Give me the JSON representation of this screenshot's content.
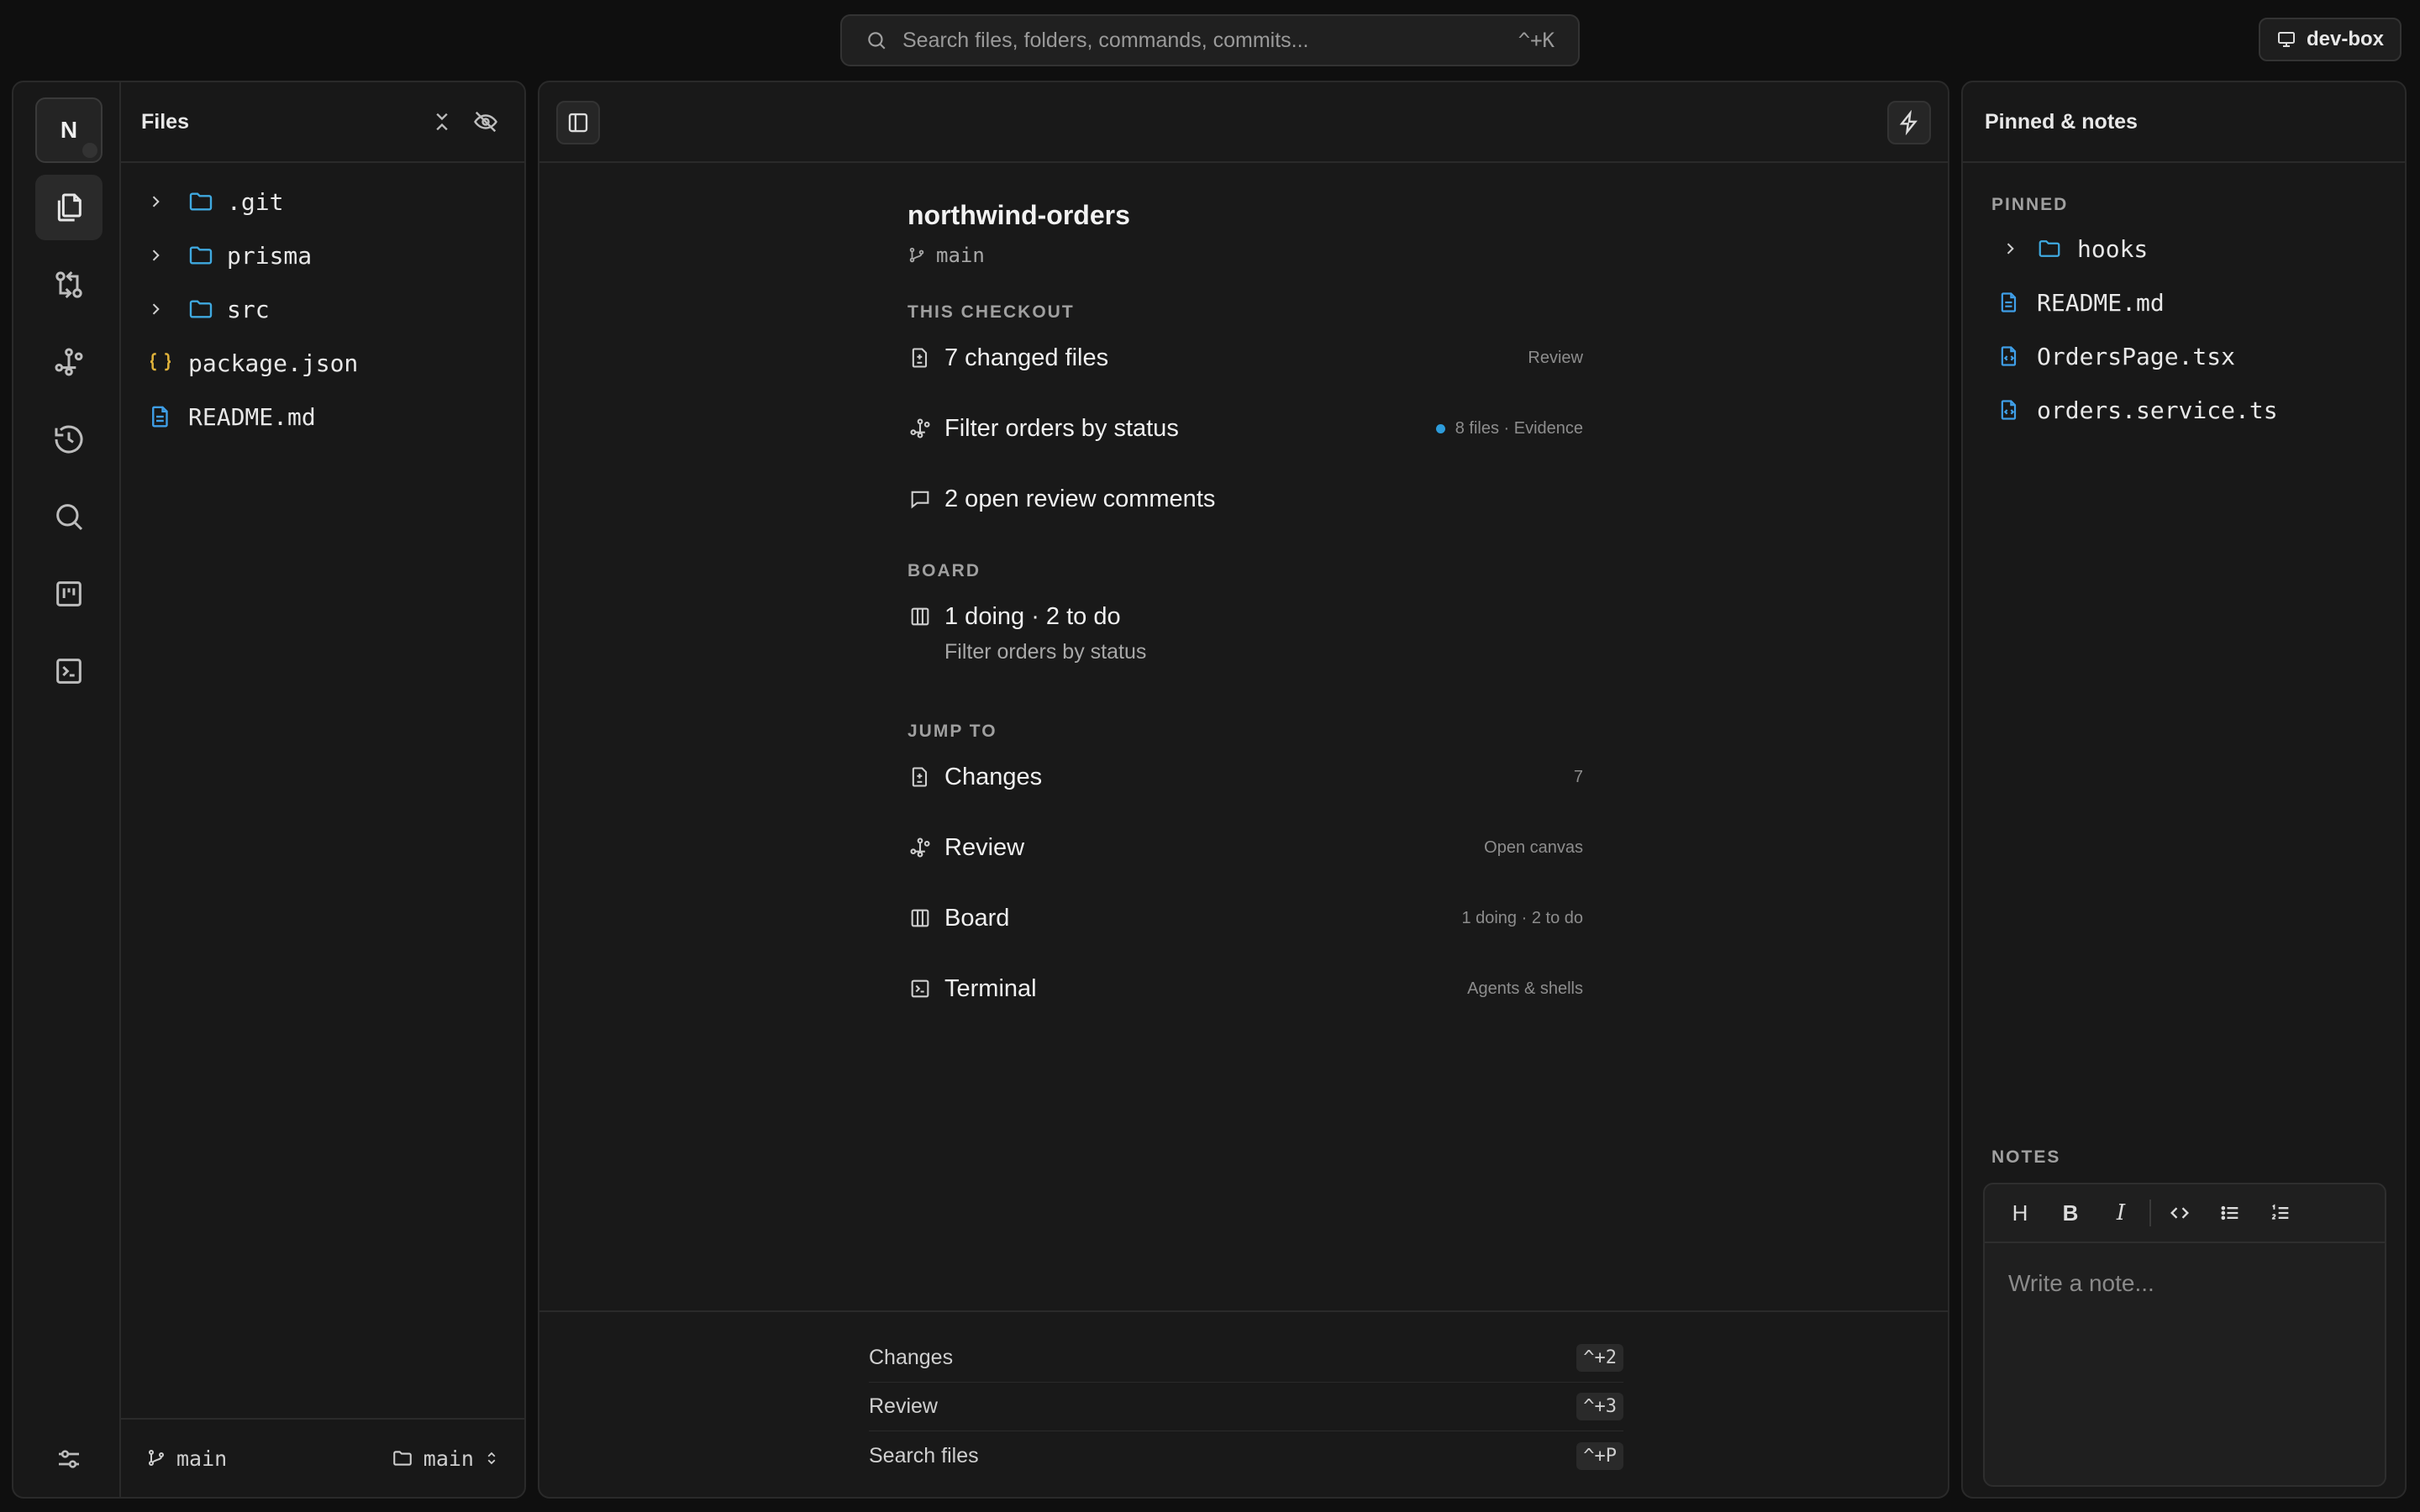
{
  "search": {
    "placeholder": "Search files, folders, commands, commits...",
    "shortcut": "^+K"
  },
  "machine": {
    "label": "dev-box"
  },
  "rail": {
    "avatar_letter": "N",
    "icons": [
      "files-icon",
      "git-compare-icon",
      "workflow-icon",
      "history-icon",
      "search-icon",
      "kanban-icon",
      "terminal-icon"
    ],
    "bottom_icon": "settings-sliders-icon"
  },
  "files_panel": {
    "title": "Files",
    "tree": [
      {
        "name": ".git",
        "type": "folder"
      },
      {
        "name": "prisma",
        "type": "folder"
      },
      {
        "name": "src",
        "type": "folder"
      },
      {
        "name": "package.json",
        "type": "json"
      },
      {
        "name": "README.md",
        "type": "doc"
      }
    ],
    "footer": {
      "branch": "main",
      "worktree": "main"
    }
  },
  "overview": {
    "repo": "northwind-orders",
    "branch": "main",
    "checkout": {
      "label": "THIS CHECKOUT",
      "changed_files": "7 changed files",
      "changed_meta": "Review",
      "task": "Filter orders by status",
      "task_meta": "8 files · Evidence",
      "comments": "2 open review comments"
    },
    "board": {
      "label": "BOARD",
      "summary": "1 doing · 2 to do",
      "sub": "Filter orders by status"
    },
    "jump": {
      "label": "JUMP TO",
      "items": [
        {
          "label": "Changes",
          "meta": "7"
        },
        {
          "label": "Review",
          "meta": "Open canvas"
        },
        {
          "label": "Board",
          "meta": "1 doing · 2 to do"
        },
        {
          "label": "Terminal",
          "meta": "Agents & shells"
        }
      ]
    }
  },
  "shortcuts": [
    {
      "label": "Changes",
      "key": "^+2"
    },
    {
      "label": "Review",
      "key": "^+3"
    },
    {
      "label": "Search files",
      "key": "^+P"
    }
  ],
  "right_panel": {
    "title": "Pinned & notes",
    "pinned_label": "PINNED",
    "pinned": [
      {
        "name": "hooks",
        "type": "folder"
      },
      {
        "name": "README.md",
        "type": "doc"
      },
      {
        "name": "OrdersPage.tsx",
        "type": "code"
      },
      {
        "name": "orders.service.ts",
        "type": "code"
      }
    ],
    "notes_label": "NOTES",
    "toolbar": {
      "heading": "H",
      "bold": "B",
      "italic": "I"
    },
    "notes_placeholder": "Write a note..."
  },
  "colors": {
    "folder": "#3fa9e0",
    "json": "#e0b23a",
    "doc": "#3f9fe8",
    "accent_dot": "#2d9cdb"
  }
}
